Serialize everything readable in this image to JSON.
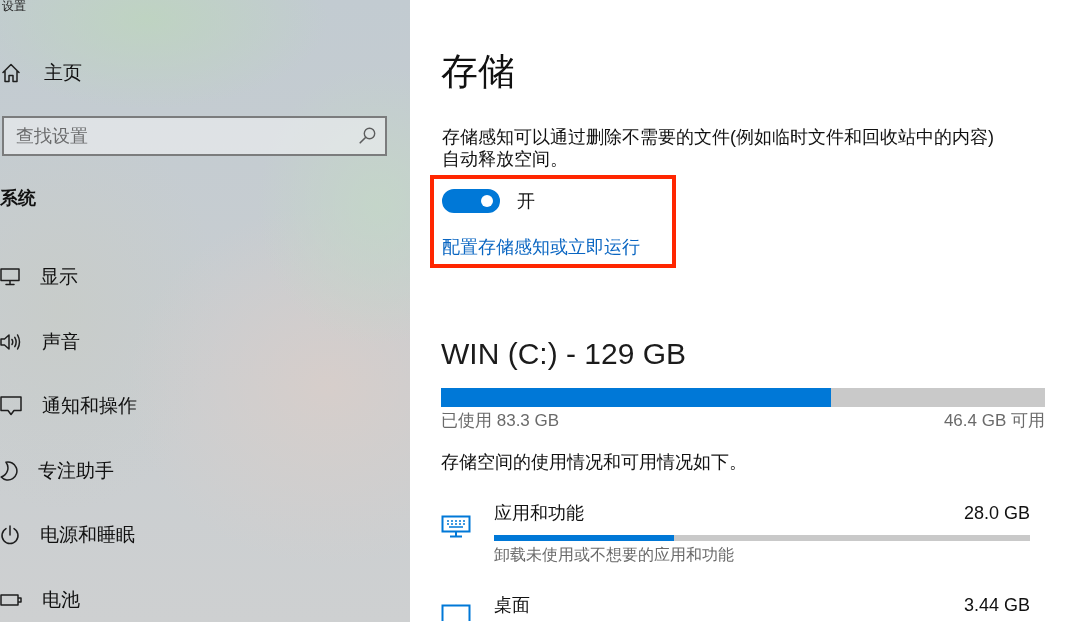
{
  "window": {
    "title": "设置"
  },
  "sidebar": {
    "home": {
      "label": "主页"
    },
    "search": {
      "placeholder": "查找设置"
    },
    "section": "系统",
    "items": [
      {
        "label": "显示"
      },
      {
        "label": "声音"
      },
      {
        "label": "通知和操作"
      },
      {
        "label": "专注助手"
      },
      {
        "label": "电源和睡眠"
      },
      {
        "label": "电池"
      }
    ]
  },
  "main": {
    "title": "存储",
    "description": "存储感知可以通过删除不需要的文件(例如临时文件和回收站中的内容)自动释放空间。",
    "storage_sense": {
      "highlighted": true,
      "on": true,
      "state_label": "开",
      "link": "配置存储感知或立即运行"
    },
    "drive": {
      "title": "WIN (C:) - 129 GB",
      "level": 0.646,
      "used": "已使用 83.3 GB",
      "free": "46.4 GB 可用"
    },
    "usage_intro": "存储空间的使用情况和可用情况如下。",
    "categories": [
      {
        "name": "应用和功能",
        "size": "28.0 GB",
        "level": 0.336,
        "description": "卸载未使用或不想要的应用和功能"
      },
      {
        "name": "桌面",
        "size": "3.44 GB"
      }
    ]
  }
}
